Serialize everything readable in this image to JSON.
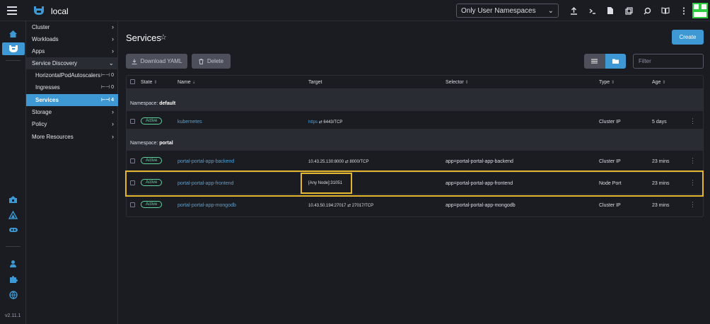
{
  "header": {
    "cluster_name": "local",
    "namespace_filter": "Only User Namespaces"
  },
  "rail": {
    "version": "v2.11.1"
  },
  "sidebar": {
    "items": [
      {
        "label": "Cluster"
      },
      {
        "label": "Workloads"
      },
      {
        "label": "Apps"
      },
      {
        "label": "Service Discovery"
      },
      {
        "label": "HorizontalPodAutoscalers",
        "count": "0"
      },
      {
        "label": "Ingresses",
        "count": "0"
      },
      {
        "label": "Services",
        "count": "4"
      },
      {
        "label": "Storage"
      },
      {
        "label": "Policy"
      },
      {
        "label": "More Resources"
      }
    ]
  },
  "main": {
    "title": "Services",
    "create_label": "Create",
    "download_label": "Download YAML",
    "delete_label": "Delete",
    "filter_placeholder": "Filter"
  },
  "table": {
    "columns": [
      "State",
      "Name",
      "Target",
      "Selector",
      "Type",
      "Age"
    ],
    "groups": [
      {
        "namespace_label": "Namespace:",
        "namespace": "default",
        "rows": [
          {
            "state": "Active",
            "name": "kubernetes",
            "target_prefix": "https",
            "target_port": "6443/TCP",
            "selector": "",
            "type": "Cluster IP",
            "age": "5 days"
          }
        ]
      },
      {
        "namespace_label": "Namespace:",
        "namespace": "portal",
        "rows": [
          {
            "state": "Active",
            "name": "portal-portal-app-backend",
            "target_prefix": "10.43.25.130:8000",
            "target_port": "8000/TCP",
            "selector": "app=portal-portal-app-backend",
            "type": "Cluster IP",
            "age": "23 mins"
          },
          {
            "state": "Active",
            "name": "portal-portal-app-frontend",
            "target_prefix": "[Any Node]:31051",
            "target_port": "",
            "selector": "app=portal-portal-app-frontend",
            "type": "Node Port",
            "age": "23 mins"
          },
          {
            "state": "Active",
            "name": "portal-portal-app-mongodb",
            "target_prefix": "10.43.50.194:27017",
            "target_port": "27017/TCP",
            "selector": "app=portal-portal-app-mongodb",
            "type": "Cluster IP",
            "age": "23 mins"
          }
        ]
      }
    ]
  },
  "colors": {
    "accent": "#3d98d3",
    "highlight": "#e4b52f",
    "active_badge": "#5dd39e"
  }
}
